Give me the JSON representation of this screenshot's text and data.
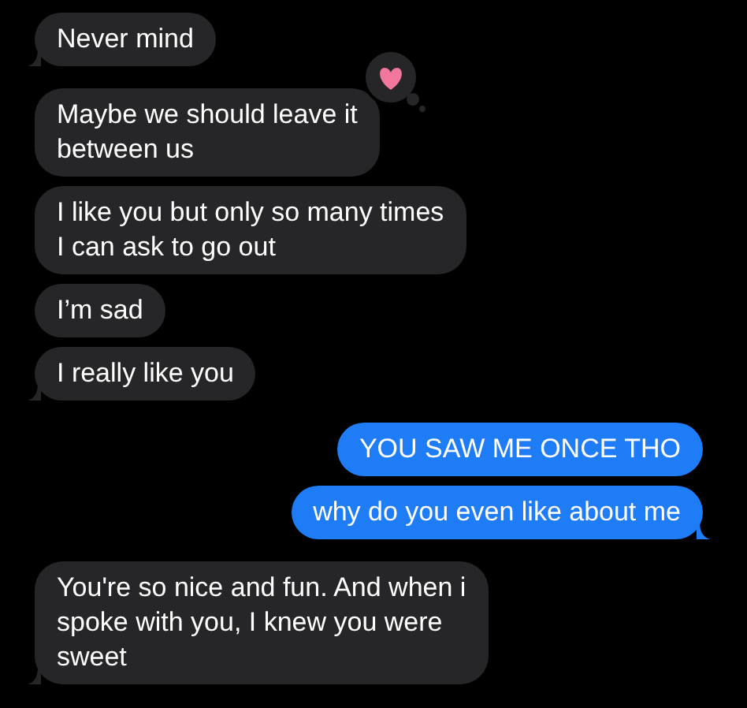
{
  "messages": [
    {
      "outgoing": false,
      "lines": [
        "Never mind"
      ],
      "tail": true,
      "hearted": false
    },
    {
      "outgoing": false,
      "lines": [
        "Maybe we should leave it",
        "between us"
      ],
      "tail": false,
      "hearted": true
    },
    {
      "outgoing": false,
      "lines": [
        "I like you but only so many times",
        "I can ask to go out"
      ],
      "tail": false,
      "hearted": false
    },
    {
      "outgoing": false,
      "lines": [
        "I’m sad"
      ],
      "tail": false,
      "hearted": false
    },
    {
      "outgoing": false,
      "lines": [
        "I really like you"
      ],
      "tail": true,
      "hearted": false
    },
    {
      "outgoing": true,
      "lines": [
        "YOU SAW ME ONCE THO"
      ],
      "tail": false,
      "hearted": false
    },
    {
      "outgoing": true,
      "lines": [
        "why do you even like about me"
      ],
      "tail": true,
      "hearted": false
    },
    {
      "outgoing": false,
      "lines": [
        "You're so nice and fun. And when i",
        "spoke with you, I knew you were",
        "sweet"
      ],
      "tail": true,
      "hearted": false
    }
  ]
}
